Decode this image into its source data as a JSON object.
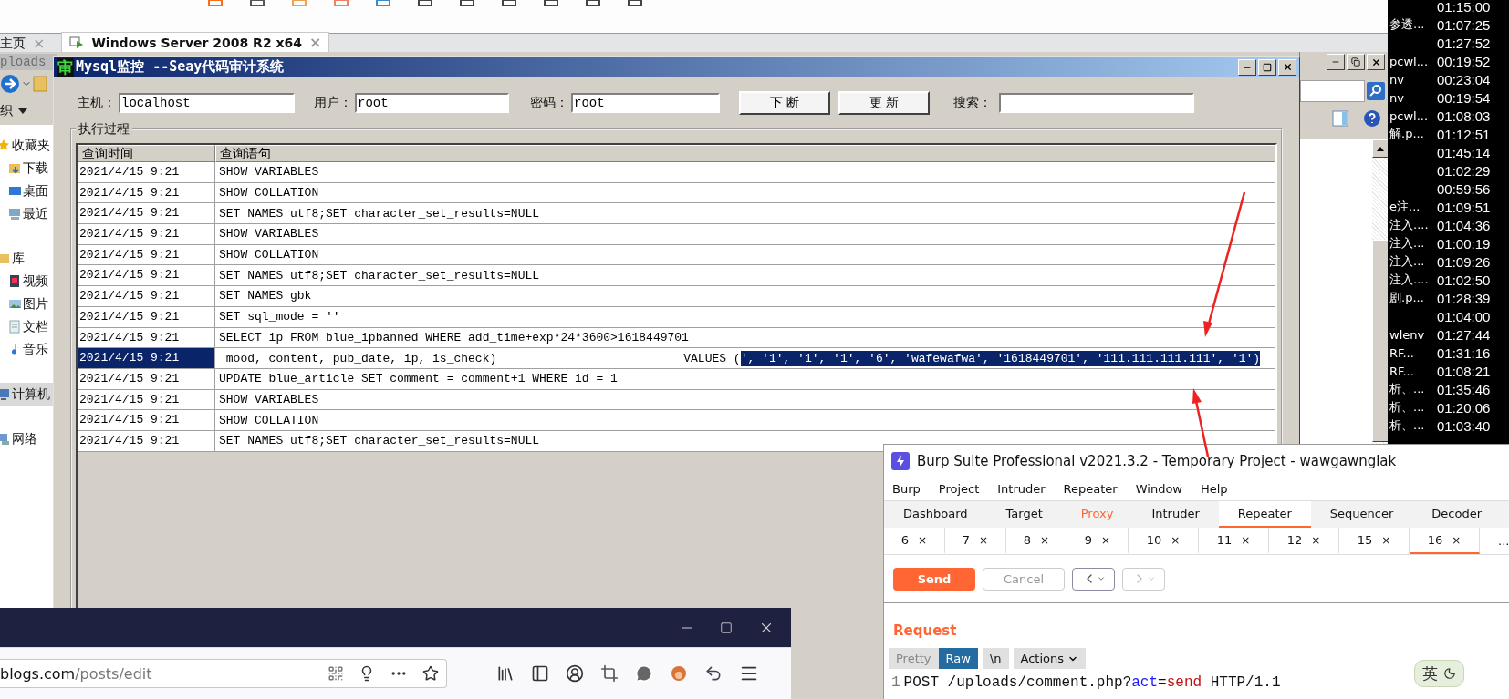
{
  "vm_tabs": [
    {
      "label": "主页",
      "close": "×",
      "selected": false
    },
    {
      "label": "Windows Server 2008 R2 x64",
      "close": "×",
      "selected": true
    }
  ],
  "explorer": {
    "address": "ploads",
    "organize": "织",
    "sidebar": [
      {
        "label": "收藏夹",
        "selected": false,
        "children": [
          {
            "label": "下载",
            "selected": false
          },
          {
            "label": "桌面",
            "selected": false
          },
          {
            "label": "最近",
            "selected": false
          }
        ]
      },
      {
        "label": "库",
        "selected": false,
        "children": [
          {
            "label": "视频",
            "selected": false
          },
          {
            "label": "图片",
            "selected": false
          },
          {
            "label": "文档",
            "selected": false
          },
          {
            "label": "音乐",
            "selected": false
          }
        ]
      },
      {
        "label": "计算机",
        "selected": true
      },
      {
        "label": "网络",
        "selected": false
      }
    ]
  },
  "mysql": {
    "icon_text": "审",
    "title": "Mysql监控 --Seay代码审计系统",
    "fields": [
      {
        "label": "主机：",
        "value": "localhost"
      },
      {
        "label": "用户：",
        "value": "root"
      },
      {
        "label": "密码：",
        "value": "root"
      }
    ],
    "buttons": [
      "下 断",
      "更 新"
    ],
    "search": {
      "label": "搜索："
    },
    "group_title": "执行过程",
    "table": {
      "columns": [
        "查询时间",
        "查询语句"
      ],
      "rows": [
        {
          "time": "2021/4/15 9:21",
          "query": "SHOW VARIABLES",
          "selected": false
        },
        {
          "time": "2021/4/15 9:21",
          "query": "SHOW COLLATION",
          "selected": false
        },
        {
          "time": "2021/4/15 9:21",
          "query": "SET NAMES utf8;SET character_set_results=NULL",
          "selected": false
        },
        {
          "time": "2021/4/15 9:21",
          "query": "SHOW VARIABLES",
          "selected": false
        },
        {
          "time": "2021/4/15 9:21",
          "query": "SHOW COLLATION",
          "selected": false
        },
        {
          "time": "2021/4/15 9:21",
          "query": "SET NAMES utf8;SET character_set_results=NULL",
          "selected": false
        },
        {
          "time": "2021/4/15 9:21",
          "query": "SET NAMES gbk",
          "selected": false
        },
        {
          "time": "2021/4/15 9:21",
          "query": "SET sql_mode = ''",
          "selected": false
        },
        {
          "time": "2021/4/15 9:21",
          "query": "SELECT ip FROM blue_ipbanned WHERE add_time+exp*24*3600>1618449701",
          "selected": false
        },
        {
          "time": "2021/4/15 9:21",
          "query": "mood, content, pub_date, ip, is_check)",
          "query_tail": "VALUES (",
          "highlight": "', '1', '1', '1', '6', 'wafewafwa', '1618449701', '111.111.111.111', '1')",
          "selected": true
        },
        {
          "time": "2021/4/15 9:21",
          "query": "UPDATE blue_article SET comment = comment+1 WHERE id = 1",
          "selected": false
        },
        {
          "time": "2021/4/15 9:21",
          "query": "SHOW VARIABLES",
          "selected": false
        },
        {
          "time": "2021/4/15 9:21",
          "query": "SHOW COLLATION",
          "selected": false
        },
        {
          "time": "2021/4/15 9:21",
          "query": "SET NAMES utf8;SET character_set_results=NULL",
          "selected": false
        }
      ]
    }
  },
  "side_list": [
    {
      "time": "01:15:00"
    },
    {
      "name": "参透...",
      "time": "01:07:25"
    },
    {
      "time": "01:27:52"
    },
    {
      "name": "pcwl...",
      "time": "00:19:52"
    },
    {
      "name": "nv",
      "time": "00:23:04"
    },
    {
      "name": "nv",
      "time": "00:19:54"
    },
    {
      "name": "pcwl...",
      "time": "01:08:03"
    },
    {
      "name": "解.p...",
      "time": "01:12:51"
    },
    {
      "time": "01:45:14"
    },
    {
      "time": "01:02:29"
    },
    {
      "time": "00:59:56"
    },
    {
      "name": "e注...",
      "time": "01:09:51"
    },
    {
      "name": "注入....",
      "time": "01:04:36"
    },
    {
      "name": "注入...",
      "time": "01:00:19"
    },
    {
      "name": "注入...",
      "time": "01:09:26"
    },
    {
      "name": "注入....",
      "time": "01:02:50"
    },
    {
      "name": "剧.p...",
      "time": "01:28:39"
    },
    {
      "time": "01:04:00"
    },
    {
      "name": "wlenv",
      "time": "01:27:44"
    },
    {
      "name": "RF...",
      "time": "01:31:16"
    },
    {
      "name": "RF...",
      "time": "01:08:21"
    },
    {
      "name": "析、...",
      "time": "01:35:46"
    },
    {
      "name": "析、...",
      "time": "01:20:06"
    },
    {
      "name": "析、...",
      "time": "01:03:40"
    }
  ],
  "burp": {
    "title": "Burp Suite Professional v2021.3.2 - Temporary Project - wawgawnglak",
    "menu": [
      "Burp",
      "Project",
      "Intruder",
      "Repeater",
      "Window",
      "Help"
    ],
    "tabs": [
      {
        "label": "Dashboard",
        "selected": false,
        "highlighted": false
      },
      {
        "label": "Target",
        "selected": false,
        "highlighted": false
      },
      {
        "label": "Proxy",
        "selected": false,
        "highlighted": true
      },
      {
        "label": "Intruder",
        "selected": false,
        "highlighted": false
      },
      {
        "label": "Repeater",
        "selected": true,
        "highlighted": false
      },
      {
        "label": "Sequencer",
        "selected": false,
        "highlighted": false
      },
      {
        "label": "Decoder",
        "selected": false,
        "highlighted": false
      }
    ],
    "repeater_tabs": [
      {
        "label": "6",
        "close": "×",
        "selected": false
      },
      {
        "label": "7",
        "close": "×",
        "selected": false
      },
      {
        "label": "8",
        "close": "×",
        "selected": false
      },
      {
        "label": "9",
        "close": "×",
        "selected": false
      },
      {
        "label": "10",
        "close": "×",
        "selected": false
      },
      {
        "label": "11",
        "close": "×",
        "selected": false
      },
      {
        "label": "12",
        "close": "×",
        "selected": false
      },
      {
        "label": "15",
        "close": "×",
        "selected": false
      },
      {
        "label": "16",
        "close": "×",
        "selected": true
      }
    ],
    "more_tabs": "...",
    "send": "Send",
    "cancel": "Cancel",
    "request_title": "Request",
    "views": [
      {
        "label": "Pretty",
        "selected": false
      },
      {
        "label": "Raw",
        "selected": true
      },
      {
        "label": "\\n",
        "selected": false
      }
    ],
    "actions": "Actions",
    "code_line": {
      "number": "1",
      "parts": [
        {
          "text": "POST /uploads/comment.php?",
          "kind": "plain"
        },
        {
          "text": "act",
          "kind": "param"
        },
        {
          "text": "=",
          "kind": "plain"
        },
        {
          "text": "send",
          "kind": "value"
        },
        {
          "text": " HTTP/1.1",
          "kind": "plain"
        }
      ]
    },
    "ime": "英"
  },
  "firefox": {
    "url_host": "blogs.com",
    "url_path": "/posts/edit"
  }
}
